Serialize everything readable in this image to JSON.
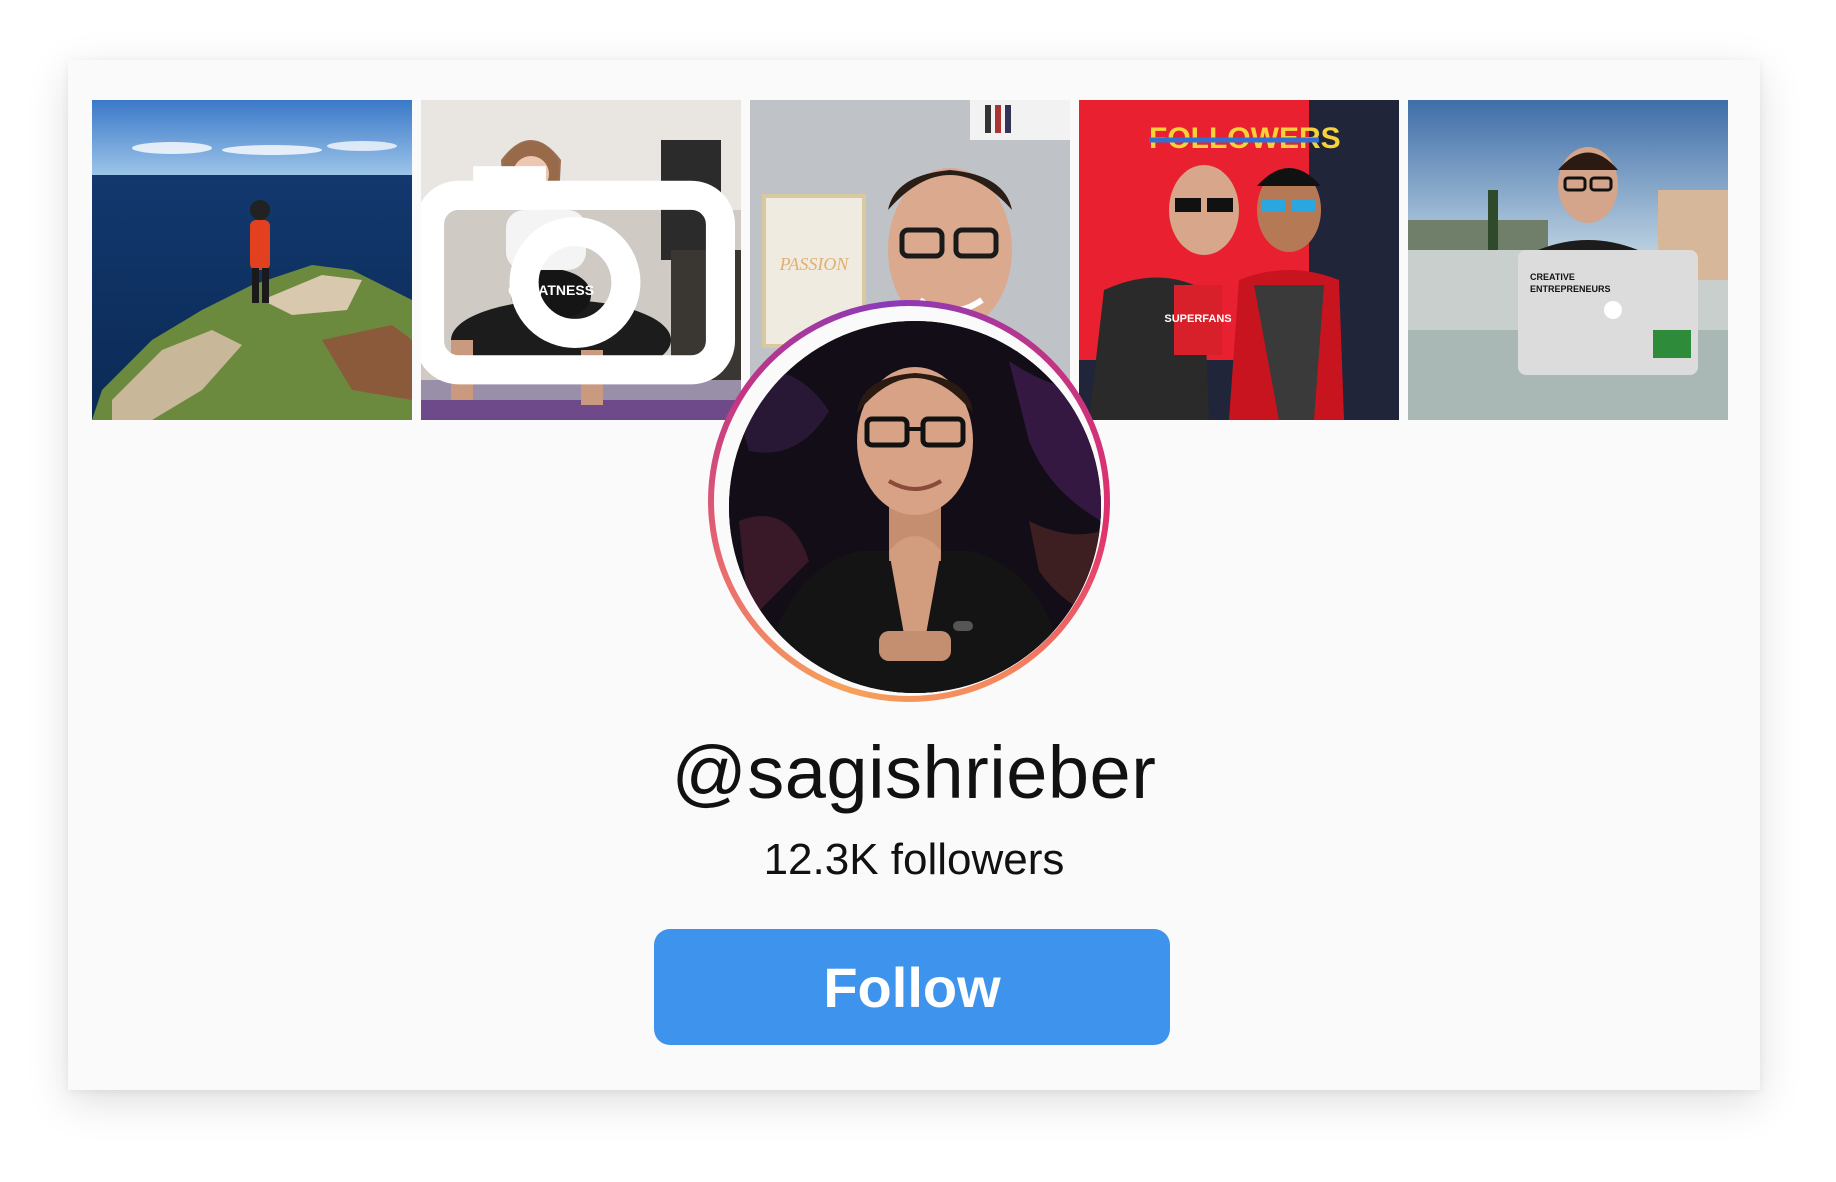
{
  "profile": {
    "username": "@sagishrieber",
    "followers_label": "12.3K followers",
    "follow_label": "Follow"
  },
  "photos": [
    {
      "subject": "cyclist standing on cliff over ocean"
    },
    {
      "subject": "girl riding on man's back doing push-up",
      "cap_text": "GREATNESS",
      "video_icon": "camera-icon"
    },
    {
      "subject": "smiling man with glasses selfie",
      "poster_text": "PASSION"
    },
    {
      "subject": "two men with sunglasses holding book",
      "wall_text": "FOLLOWERS",
      "book_text": "SUPERFANS"
    },
    {
      "subject": "man with laptop on rooftop terrace",
      "laptop_text": "CREATIVE ENTREPRENEURS"
    }
  ],
  "colors": {
    "button": "#3e93ec",
    "ring_start": "#f6a15a",
    "ring_end": "#c13584",
    "card": "#fafafa"
  }
}
